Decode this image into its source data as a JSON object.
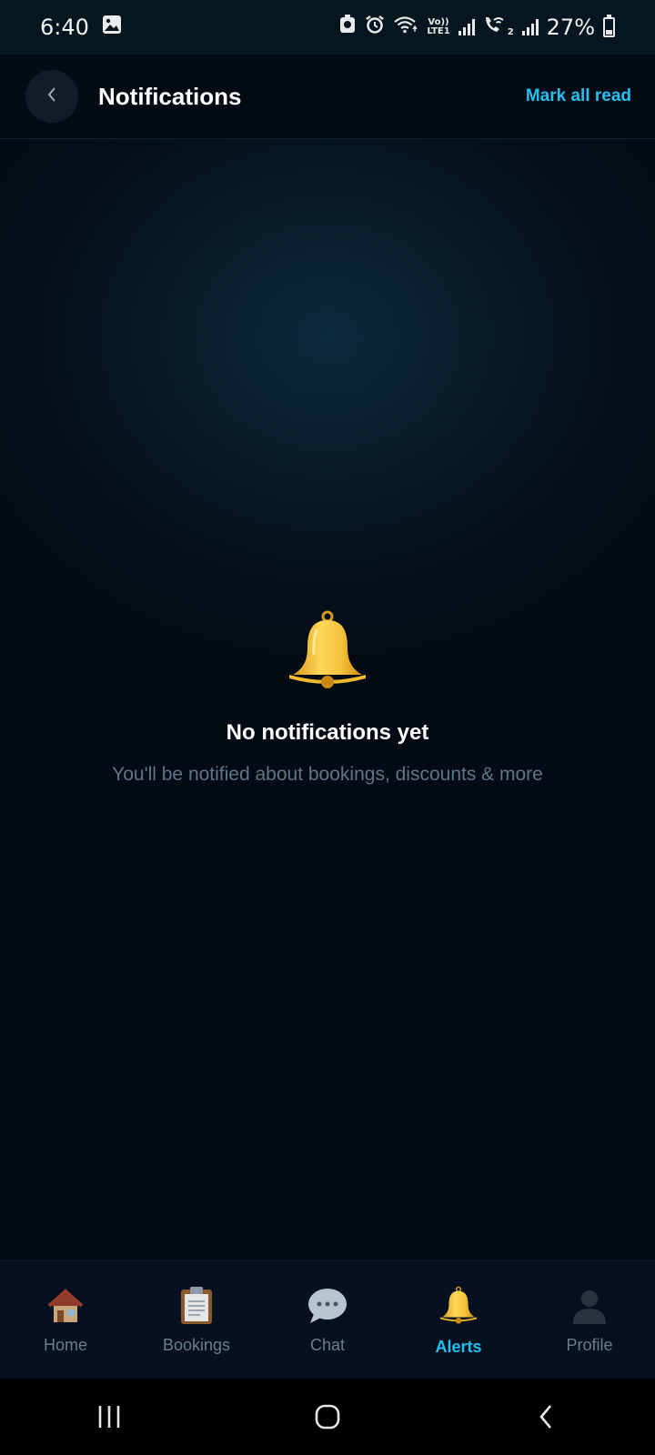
{
  "status_bar": {
    "time": "6:40",
    "battery_percent": "27%",
    "volte_tag_top": "Vo))",
    "volte_tag_bottom": "LTE1",
    "sim2_tag": "2",
    "icons": [
      "gallery-icon",
      "shield-icon",
      "alarm-icon",
      "wifi-icon",
      "signal-icon",
      "wifi-calling-icon",
      "battery-icon"
    ]
  },
  "header": {
    "title": "Notifications",
    "mark_all_read_label": "Mark all read",
    "back_icon": "chevron-left-icon"
  },
  "empty_state": {
    "icon": "bell-icon",
    "title": "No notifications yet",
    "subtitle": "You'll be notified about bookings, discounts & more"
  },
  "tabs": [
    {
      "label": "Home",
      "icon": "house-icon",
      "active": false
    },
    {
      "label": "Bookings",
      "icon": "clipboard-icon",
      "active": false
    },
    {
      "label": "Chat",
      "icon": "speech-bubble-icon",
      "active": false
    },
    {
      "label": "Alerts",
      "icon": "bell-icon",
      "active": true
    },
    {
      "label": "Profile",
      "icon": "person-icon",
      "active": false
    }
  ],
  "colors": {
    "accent": "#22c0f0",
    "background": "#040b14",
    "muted_text": "#5f7689"
  }
}
